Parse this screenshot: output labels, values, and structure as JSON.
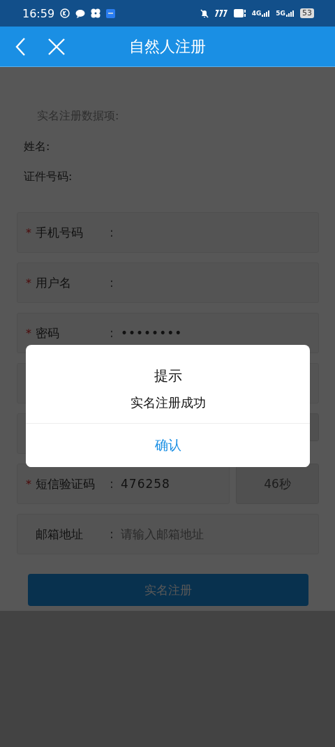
{
  "status_bar": {
    "time": "16:59",
    "network": [
      "4G",
      "5G"
    ],
    "battery": "53"
  },
  "header": {
    "title": "自然人注册"
  },
  "info": {
    "heading": "实名注册数据项:",
    "items": [
      {
        "label": "姓名:"
      },
      {
        "label": "证件号码:"
      }
    ]
  },
  "form": {
    "rows": [
      {
        "kind": "field",
        "required_mark": "*",
        "label": "手机号码",
        "colon": ":"
      },
      {
        "kind": "field",
        "required_mark": "*",
        "label": "用户名",
        "colon": ":"
      },
      {
        "kind": "field",
        "required_mark": "*",
        "label": "密码",
        "colon": ":",
        "value": "••••••••"
      },
      {
        "kind": "covered"
      },
      {
        "kind": "covered-button"
      },
      {
        "kind": "code",
        "required_mark": "*",
        "label": "短信验证码",
        "colon": ":",
        "value": "476258",
        "button": "46秒"
      },
      {
        "kind": "field",
        "label": "邮箱地址",
        "colon": ":",
        "placeholder": "请输入邮箱地址"
      }
    ],
    "submit": "实名注册"
  },
  "dialog": {
    "title": "提示",
    "message": "实名注册成功",
    "confirm": "确认"
  }
}
